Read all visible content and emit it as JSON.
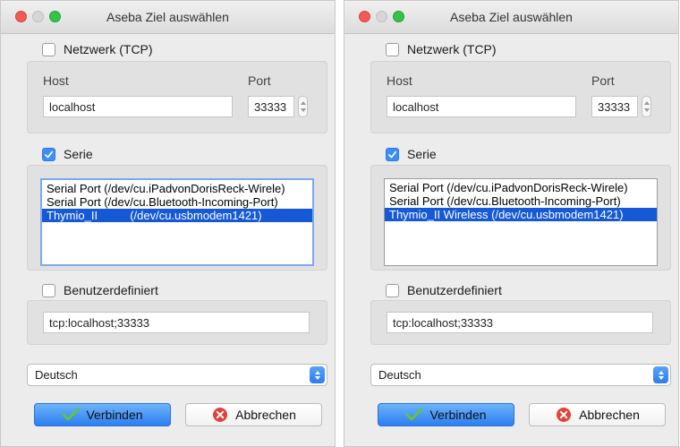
{
  "dialogs": [
    {
      "title": "Aseba Ziel auswählen",
      "network": {
        "label": "Netzwerk (TCP)",
        "checked": false,
        "host_label": "Host",
        "host_value": "localhost",
        "port_label": "Port",
        "port_value": "33333"
      },
      "serial": {
        "label": "Serie",
        "checked": true,
        "items": [
          {
            "label": "Serial Port (/dev/cu.iPadvonDorisReck-Wirele)",
            "selected": false
          },
          {
            "label": "Serial Port (/dev/cu.Bluetooth-Incoming-Port)",
            "selected": false
          },
          {
            "label": "Thymio_II          (/dev/cu.usbmodem1421)",
            "selected": true
          }
        ]
      },
      "custom": {
        "label": "Benutzerdefiniert",
        "checked": false,
        "value": "tcp:localhost;33333"
      },
      "language": {
        "selected": "Deutsch"
      },
      "buttons": {
        "connect": "Verbinden",
        "cancel": "Abbrechen"
      }
    },
    {
      "title": "Aseba Ziel auswählen",
      "network": {
        "label": "Netzwerk (TCP)",
        "checked": false,
        "host_label": "Host",
        "host_value": "localhost",
        "port_label": "Port",
        "port_value": "33333"
      },
      "serial": {
        "label": "Serie",
        "checked": true,
        "items": [
          {
            "label": "Serial Port (/dev/cu.iPadvonDorisReck-Wirele)",
            "selected": false
          },
          {
            "label": "Serial Port (/dev/cu.Bluetooth-Incoming-Port)",
            "selected": false
          },
          {
            "label": "Thymio_II Wireless (/dev/cu.usbmodem1421)",
            "selected": true
          }
        ]
      },
      "custom": {
        "label": "Benutzerdefiniert",
        "checked": false,
        "value": "tcp:localhost;33333"
      },
      "language": {
        "selected": "Deutsch"
      },
      "buttons": {
        "connect": "Verbinden",
        "cancel": "Abbrechen"
      }
    }
  ],
  "colors": {
    "accent": "#2c7ef1",
    "selection": "#1559d6",
    "close": "#f25a55",
    "zoom": "#35c248",
    "cancel_icon": "#e2443c",
    "connect_icon": "#66c23a"
  }
}
